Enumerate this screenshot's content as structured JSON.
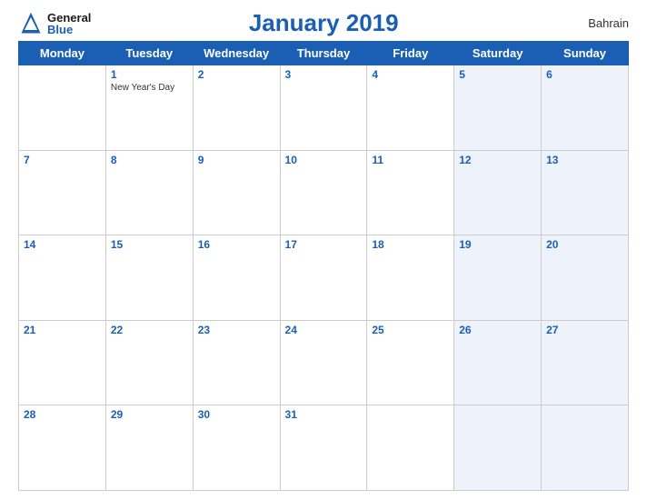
{
  "header": {
    "logo_general": "General",
    "logo_blue": "Blue",
    "title": "January 2019",
    "country": "Bahrain"
  },
  "weekdays": [
    "Monday",
    "Tuesday",
    "Wednesday",
    "Thursday",
    "Friday",
    "Saturday",
    "Sunday"
  ],
  "weeks": [
    [
      {
        "day": "",
        "holiday": ""
      },
      {
        "day": "1",
        "holiday": "New Year's Day"
      },
      {
        "day": "2",
        "holiday": ""
      },
      {
        "day": "3",
        "holiday": ""
      },
      {
        "day": "4",
        "holiday": ""
      },
      {
        "day": "5",
        "holiday": ""
      },
      {
        "day": "6",
        "holiday": ""
      }
    ],
    [
      {
        "day": "7",
        "holiday": ""
      },
      {
        "day": "8",
        "holiday": ""
      },
      {
        "day": "9",
        "holiday": ""
      },
      {
        "day": "10",
        "holiday": ""
      },
      {
        "day": "11",
        "holiday": ""
      },
      {
        "day": "12",
        "holiday": ""
      },
      {
        "day": "13",
        "holiday": ""
      }
    ],
    [
      {
        "day": "14",
        "holiday": ""
      },
      {
        "day": "15",
        "holiday": ""
      },
      {
        "day": "16",
        "holiday": ""
      },
      {
        "day": "17",
        "holiday": ""
      },
      {
        "day": "18",
        "holiday": ""
      },
      {
        "day": "19",
        "holiday": ""
      },
      {
        "day": "20",
        "holiday": ""
      }
    ],
    [
      {
        "day": "21",
        "holiday": ""
      },
      {
        "day": "22",
        "holiday": ""
      },
      {
        "day": "23",
        "holiday": ""
      },
      {
        "day": "24",
        "holiday": ""
      },
      {
        "day": "25",
        "holiday": ""
      },
      {
        "day": "26",
        "holiday": ""
      },
      {
        "day": "27",
        "holiday": ""
      }
    ],
    [
      {
        "day": "28",
        "holiday": ""
      },
      {
        "day": "29",
        "holiday": ""
      },
      {
        "day": "30",
        "holiday": ""
      },
      {
        "day": "31",
        "holiday": ""
      },
      {
        "day": "",
        "holiday": ""
      },
      {
        "day": "",
        "holiday": ""
      },
      {
        "day": "",
        "holiday": ""
      }
    ]
  ]
}
